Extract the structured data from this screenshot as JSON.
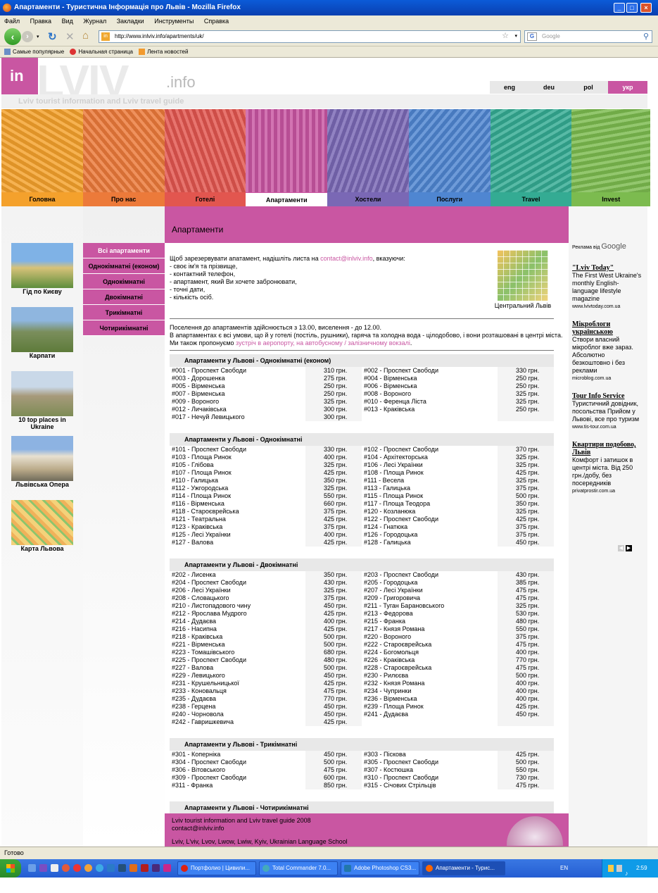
{
  "window": {
    "title": "Апартаменти - Туристична Інформація про Львів - Mozilla Firefox"
  },
  "menu": [
    "Файл",
    "Правка",
    "Вид",
    "Журнал",
    "Закладки",
    "Инструменты",
    "Справка"
  ],
  "nav": {
    "url": "http://www.inlviv.info/apartments/uk/",
    "search_placeholder": "Google",
    "search_engine_icon": "G"
  },
  "bookmarks": [
    "Самые популярные",
    "Начальная страница",
    "Лента новостей"
  ],
  "site": {
    "logo_text": "in",
    "logo_big": "LVIV",
    "logo_info": ".info",
    "tagline": "Lviv tourist information and Lviv travel guide",
    "langs": [
      "eng",
      "deu",
      "pol",
      "укр"
    ],
    "tabs": [
      {
        "label": "Головна",
        "color": "#f4a12c"
      },
      {
        "label": "Про нас",
        "color": "#ec7a3a"
      },
      {
        "label": "Готелі",
        "color": "#e2564f"
      },
      {
        "label": "Апартаменти",
        "color": "#c956a2"
      },
      {
        "label": "Хостели",
        "color": "#7a68b5"
      },
      {
        "label": "Послуги",
        "color": "#4f86d1"
      },
      {
        "label": "Travel",
        "color": "#34ab93"
      },
      {
        "label": "Invest",
        "color": "#7cbb4f"
      }
    ],
    "left_links": [
      "Гід по Києву",
      "Карпати",
      "10 top places in Ukraine",
      "Львівська Опера",
      "Карта Львова"
    ],
    "submenu": [
      "Всі апартаменти",
      "Однокімнатні (економ)",
      "Однокімнатні",
      "Двокімнатні",
      "Трикімнатні",
      "Чотирикімнатні"
    ],
    "page_title": "Апартаменти",
    "intro": {
      "lead": "Щоб зарезервувати апатамент, надішліть листа на ",
      "email": "contact@inlviv.info",
      "lead_end": ", вказуючи:",
      "items": [
        "- своє ім'я та прізвище,",
        "- контактний телефон,",
        "- апартамент, який Ви хочете забронювати,",
        "- точні дати,",
        "- кількість осіб."
      ]
    },
    "map_caption": "Центральний Львів",
    "conditions": {
      "line1": "Поселення до апартаментів здійснюється з 13.00, виселення - до 12.00.",
      "line2": "В апартаментах є всі умови, що й у готелі (постіль, рушники), гаряча та холодна вода - цілодобово, і вони розташовані в центрі міста.",
      "line3": "Ми також пропонуємо ",
      "link": "зустріч в аеропорту, на автобусному / залізничному вокзалі",
      "line3_end": "."
    },
    "sections": [
      {
        "title": "Апартаменти у Львові - Однокімнатні (економ)",
        "rows": [
          [
            "#001 - Проспект Свободи",
            "310 грн.",
            "#002 - Проспект Свободи",
            "330 грн."
          ],
          [
            "#003 - Дорошенка",
            "275 грн.",
            "#004 - Вірменська",
            "250 грн."
          ],
          [
            "#005 - Вірменська",
            "250 грн.",
            "#006 - Вірменська",
            "250 грн."
          ],
          [
            "#007 - Вірменська",
            "250 грн.",
            "#008 - Вороного",
            "325 грн."
          ],
          [
            "#009 - Вороного",
            "325 грн.",
            "#010 - Ференца Ліста",
            "325 грн."
          ],
          [
            "#012 - Личаківська",
            "300 грн.",
            "#013 - Краківська",
            "250 грн."
          ],
          [
            "#017 - Нечуй Левицького",
            "300 грн.",
            "",
            ""
          ]
        ]
      },
      {
        "title": "Апартаменти у Львові - Однокімнатні",
        "rows": [
          [
            "#101 - Проспект Свободи",
            "330 грн.",
            "#102 - Проспект Свободи",
            "370 грн."
          ],
          [
            "#103 - Площа Ринок",
            "400 грн.",
            "#104 - Архітекторська",
            "325 грн."
          ],
          [
            "#105 - Глібова",
            "325 грн.",
            "#106 - Лесі Українки",
            "325 грн."
          ],
          [
            "#107 - Площа Ринок",
            "425 грн.",
            "#108 - Площа Ринок",
            "425 грн."
          ],
          [
            "#110 - Галицька",
            "350 грн.",
            "#111 - Весела",
            "325 грн."
          ],
          [
            "#112 - Ужгородська",
            "325 грн.",
            "#113 - Галицька",
            "375 грн."
          ],
          [
            "#114 - Площа Ринок",
            "550 грн.",
            "#115 - Площа Ринок",
            "500 грн."
          ],
          [
            "#116 - Вірменська",
            "660 грн.",
            "#117 - Площа Теодора",
            "350 грн."
          ],
          [
            "#118 - Староєврейська",
            "375 грн.",
            "#120 - Козланюка",
            "325 грн."
          ],
          [
            "#121 - Театральна",
            "425 грн.",
            "#122 - Проспект Свободи",
            "425 грн."
          ],
          [
            "#123 - Краківська",
            "375 грн.",
            "#124 - Гнатюка",
            "375 грн."
          ],
          [
            "#125 - Лесі Українки",
            "400 грн.",
            "#126 - Городоцька",
            "375 грн."
          ],
          [
            "#127 - Валова",
            "425 грн.",
            "#128 - Галицька",
            "450 грн."
          ]
        ]
      },
      {
        "title": "Апартаменти у Львові - Двокімнатні",
        "rows": [
          [
            "#202 - Лисенка",
            "350 грн.",
            "#203 - Проспект Свободи",
            "430 грн."
          ],
          [
            "#204 - Проспект Свободи",
            "430 грн.",
            "#205 - Городоцька",
            "385 грн."
          ],
          [
            "#206 - Лесі Українки",
            "325 грн.",
            "#207 - Лесі Українки",
            "475 грн."
          ],
          [
            "#208 - Словацького",
            "375 грн.",
            "#209 - Григоровича",
            "475 грн."
          ],
          [
            "#210 - Листопадового чину",
            "450 грн.",
            "#211 - Туган Барановського",
            "325 грн."
          ],
          [
            "#212 - Ярослава Мудрого",
            "425 грн.",
            "#213 - Федорова",
            "530 грн."
          ],
          [
            "#214 - Дудаєва",
            "400 грн.",
            "#215 - Франка",
            "480 грн."
          ],
          [
            "#216 - Насипна",
            "425 грн.",
            "#217 - Князя Романа",
            "550 грн."
          ],
          [
            "#218 - Краківська",
            "500 грн.",
            "#220 - Вороного",
            "375 грн."
          ],
          [
            "#221 - Вірменська",
            "500 грн.",
            "#222 - Староєврейська",
            "475 грн."
          ],
          [
            "#223 - Томашівського",
            "680 грн.",
            "#224 - Богомольця",
            "400 грн."
          ],
          [
            "#225 - Проспект Свободи",
            "480 грн.",
            "#226 - Краківська",
            "770 грн."
          ],
          [
            "#227 - Валова",
            "500 грн.",
            "#228 - Староєврейська",
            "475 грн."
          ],
          [
            "#229 - Левицького",
            "450 грн.",
            "#230 - Рилєєва",
            "500 грн."
          ],
          [
            "#231 - Крушельницької",
            "425 грн.",
            "#232 - Князя Романа",
            "400 грн."
          ],
          [
            "#233 - Коновальця",
            "475 грн.",
            "#234 - Чупринки",
            "400 грн."
          ],
          [
            "#235 - Дудаєва",
            "770 грн.",
            "#236 - Вірменська",
            "400 грн."
          ],
          [
            "#238 - Герцена",
            "450 грн.",
            "#239 - Площа Ринок",
            "425 грн."
          ],
          [
            "#240 - Чорновола",
            "450 грн.",
            "#241 - Дудаєва",
            "450 грн."
          ],
          [
            "#242 - Гавришкевича",
            "425 грн.",
            "",
            ""
          ]
        ]
      },
      {
        "title": "Апартаменти у Львові - Трикімнатні",
        "rows": [
          [
            "#301 - Коперніка",
            "450 грн.",
            "#303 - Піскова",
            "425 грн."
          ],
          [
            "#304 - Проспект Свободи",
            "500 грн.",
            "#305 - Проспект Свободи",
            "500 грн."
          ],
          [
            "#306 - Вітовського",
            "475 грн.",
            "#307 - Костюшка",
            "550 грн."
          ],
          [
            "#309 - Проспект Свободи",
            "600 грн.",
            "#310 - Проспект Свободи",
            "730 грн."
          ],
          [
            "#311 - Франка",
            "850 грн.",
            "#315 - Січових Стрільців",
            "475 грн."
          ]
        ]
      },
      {
        "title": "Апартаменти у Львові - Чотирикімнатні",
        "rows": [
          [
            "#401 - Проспект Шевченка",
            "600 грн.",
            "#402 - Боровиковського",
            "850 грн."
          ],
          [
            "#403 - Площа Соборна",
            "550 грн.",
            "#404 - Площа Теодора",
            "600 грн."
          ]
        ]
      }
    ],
    "footer": {
      "line1": "Lviv tourist information and Lviv travel guide 2008",
      "line2": "contact@inlviv.info",
      "line3": "Lviv, L'viv, Lvov, Lwow, Lwiw, Kyiv, Ukrainian Language School"
    },
    "ads": {
      "label": "Реклама від",
      "label_brand": "Google",
      "items": [
        {
          "title": "\"Lviv Today\"",
          "body": "The First West Ukraine's monthly English-language lifestyle magazine",
          "url": "www.lvivtoday.com.ua"
        },
        {
          "title": "Мікроблоги українською",
          "body": "Створи власний мікроблог вже зараз. Абсолютно безкоштовно і без реклами",
          "url": "microblog.com.ua"
        },
        {
          "title": "Tour Info Service",
          "body": "Туристичний довідник, посольства Прийом у Львові, все про туризм",
          "url": "www.tis-tour.com.ua"
        },
        {
          "title": "Квартири подобово, Львів",
          "body": "Комфорт і затишок в центрі міста. Від 250 грн./добу, без посередників",
          "url": "privatprostir.com.ua"
        }
      ]
    }
  },
  "status": {
    "text": "Готово"
  },
  "taskbar": {
    "tasks": [
      "Портфолио | Цивили...",
      "Total Commander 7.0...",
      "Adobe Photoshop CS3...",
      "Апартаменти - Турис..."
    ],
    "lang": "EN",
    "clock": "2:59"
  }
}
